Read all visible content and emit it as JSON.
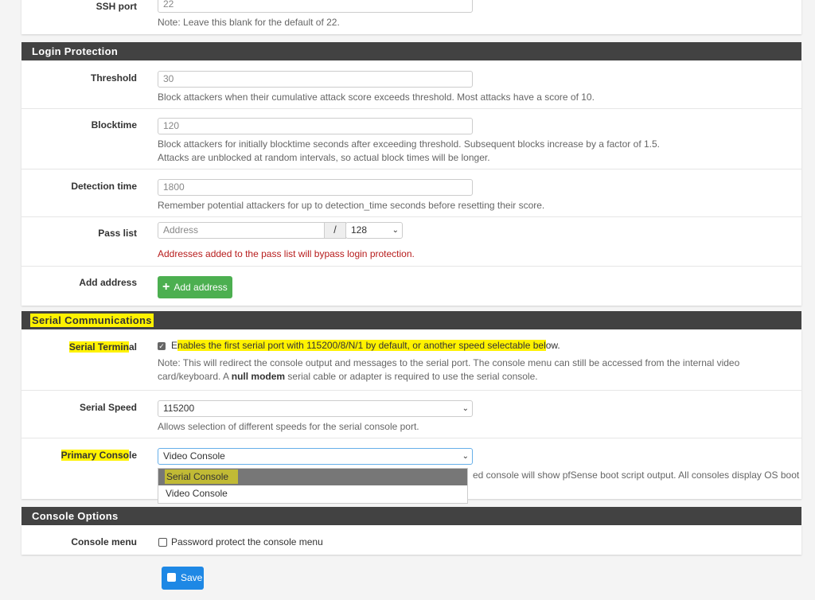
{
  "ssh": {
    "label": "SSH port",
    "value": "22",
    "note": "Note: Leave this blank for the default of 22."
  },
  "login": {
    "title": "Login Protection",
    "threshold": {
      "label": "Threshold",
      "value": "30",
      "help": "Block attackers when their cumulative attack score exceeds threshold. Most attacks have a score of 10."
    },
    "blocktime": {
      "label": "Blocktime",
      "value": "120",
      "help1": "Block attackers for initially blocktime seconds after exceeding threshold. Subsequent blocks increase by a factor of 1.5.",
      "help2": "Attacks are unblocked at random intervals, so actual block times will be longer."
    },
    "detection": {
      "label": "Detection time",
      "value": "1800",
      "help": "Remember potential attackers for up to detection_time seconds before resetting their score."
    },
    "passlist": {
      "label": "Pass list",
      "placeholder": "Address",
      "slash": "/",
      "mask": "128",
      "warning": "Addresses added to the pass list will bypass login protection."
    },
    "add": {
      "label": "Add address",
      "button": "Add address"
    }
  },
  "serial": {
    "title": "Serial Communications",
    "terminal": {
      "label_hl": "Serial Termin",
      "label_rest": "al",
      "checked": true,
      "text_pre": "E",
      "text_hl": "nables the first serial port with 115200/8/N/1 by default, or another speed selectable bel",
      "text_post": "ow.",
      "note_pre": "Note: This will redirect the console output and messages to the serial port. The console menu can still be accessed from the internal video card/keyboard. A ",
      "note_bold": "null modem",
      "note_post": " serial cable or adapter is required to use the serial console."
    },
    "speed": {
      "label": "Serial Speed",
      "value": "115200",
      "help": "Allows selection of different speeds for the serial console port."
    },
    "primary": {
      "label_hl": "Primary Conso",
      "label_rest": "le",
      "value": "Video Console",
      "help_visible": "ed console will show pfSense boot script output. All consoles display OS boot",
      "options": [
        "Serial Console",
        "Video Console"
      ]
    }
  },
  "console": {
    "title": "Console Options",
    "menu": {
      "label": "Console menu",
      "checked": false,
      "text": "Password protect the console menu"
    }
  },
  "save": "Save",
  "colors": {
    "header": "#424242",
    "success": "#4caf50",
    "primary": "#1e88e5",
    "warning": "#b71c1c",
    "highlight": "#fff200"
  }
}
